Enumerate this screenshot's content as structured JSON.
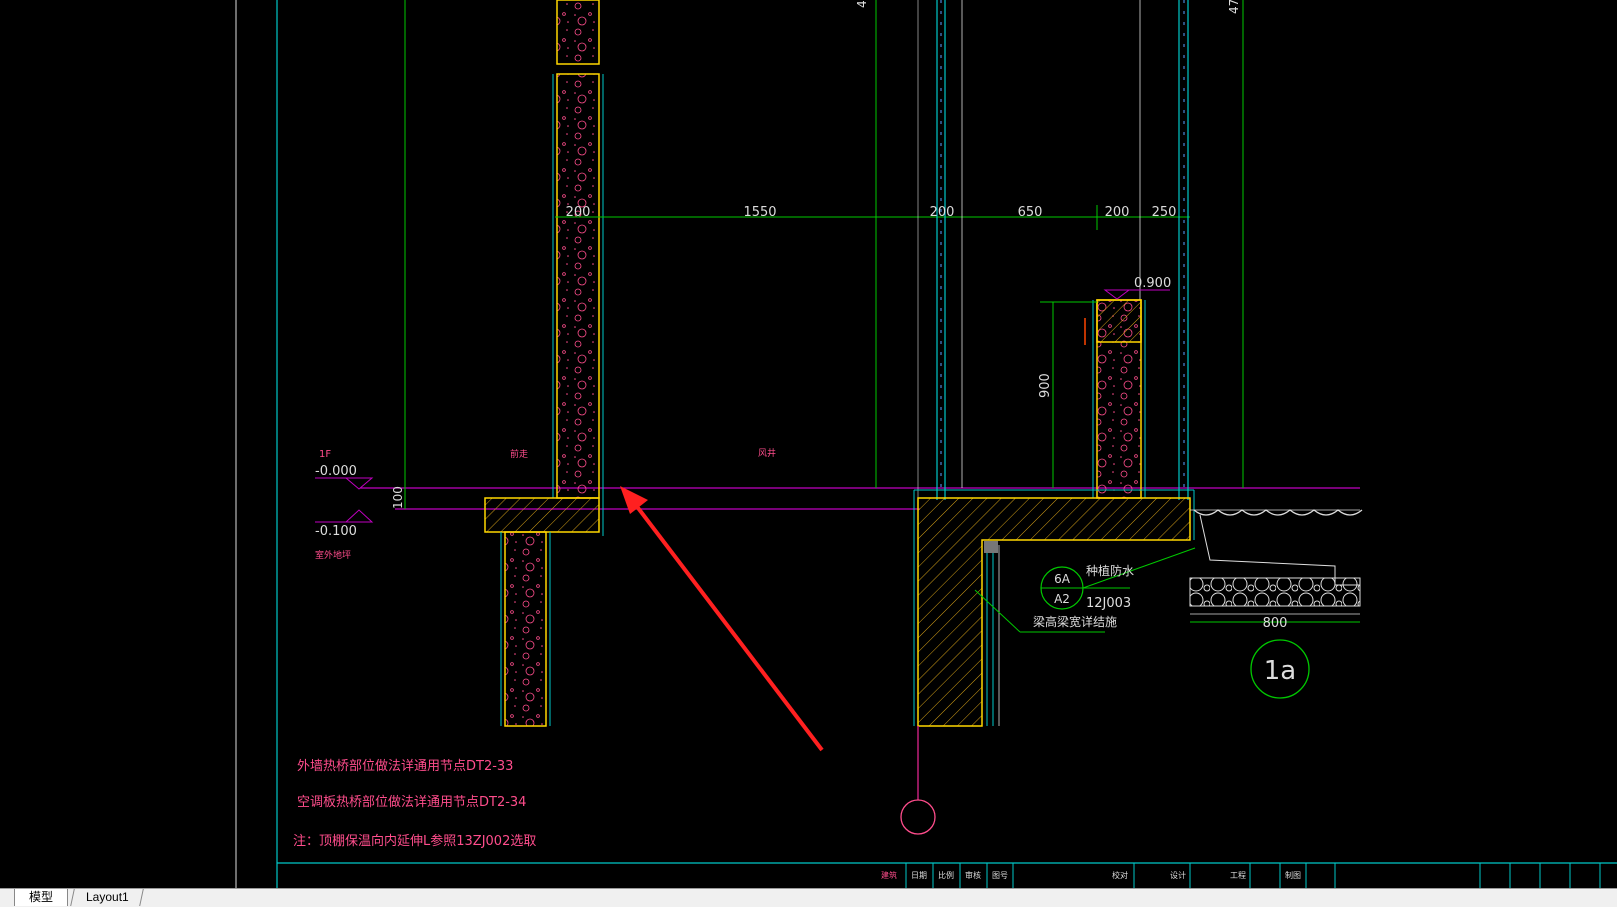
{
  "dimensions": {
    "top": [
      "200",
      "1550",
      "200",
      "650",
      "200",
      "250"
    ],
    "parapet_height": "900",
    "slab_thickness": "100",
    "gravel_width": "800"
  },
  "levels": {
    "floor_tag": "1F",
    "floor_level": "-0.000",
    "outdoor_level": "-0.100",
    "outdoor_label": "室外地坪",
    "parapet_top": "0.900"
  },
  "room_labels": {
    "left": "前走",
    "right": "风井"
  },
  "details": {
    "planting_waterproof": "种植防水",
    "index_top": "6A",
    "index_bottom": "A2",
    "atlas_code": "12J003",
    "beam_note": "梁高梁宽详结施",
    "section_mark": "1a"
  },
  "top_marks": [
    "4",
    "47"
  ],
  "notes": [
    "外墙热桥部位做法详通用节点DT2-33",
    "空调板热桥部位做法详通用节点DT2-34",
    "注：顶棚保温向内延伸L参照13ZJ002选取"
  ],
  "title_block": [
    "建筑",
    "日期",
    "比例",
    "审核",
    "图号",
    "校对",
    "设计",
    "工程",
    "制图"
  ],
  "tabs": {
    "model": "模型",
    "layout1": "Layout1"
  },
  "colors": {
    "background": "#000000",
    "border": "#00c8c8",
    "dimension": "#00c800",
    "level_line": "#c000c0",
    "wall_outline": "#ffd700",
    "annotation": "#ff4d8c",
    "arrow": "#ff2020"
  }
}
